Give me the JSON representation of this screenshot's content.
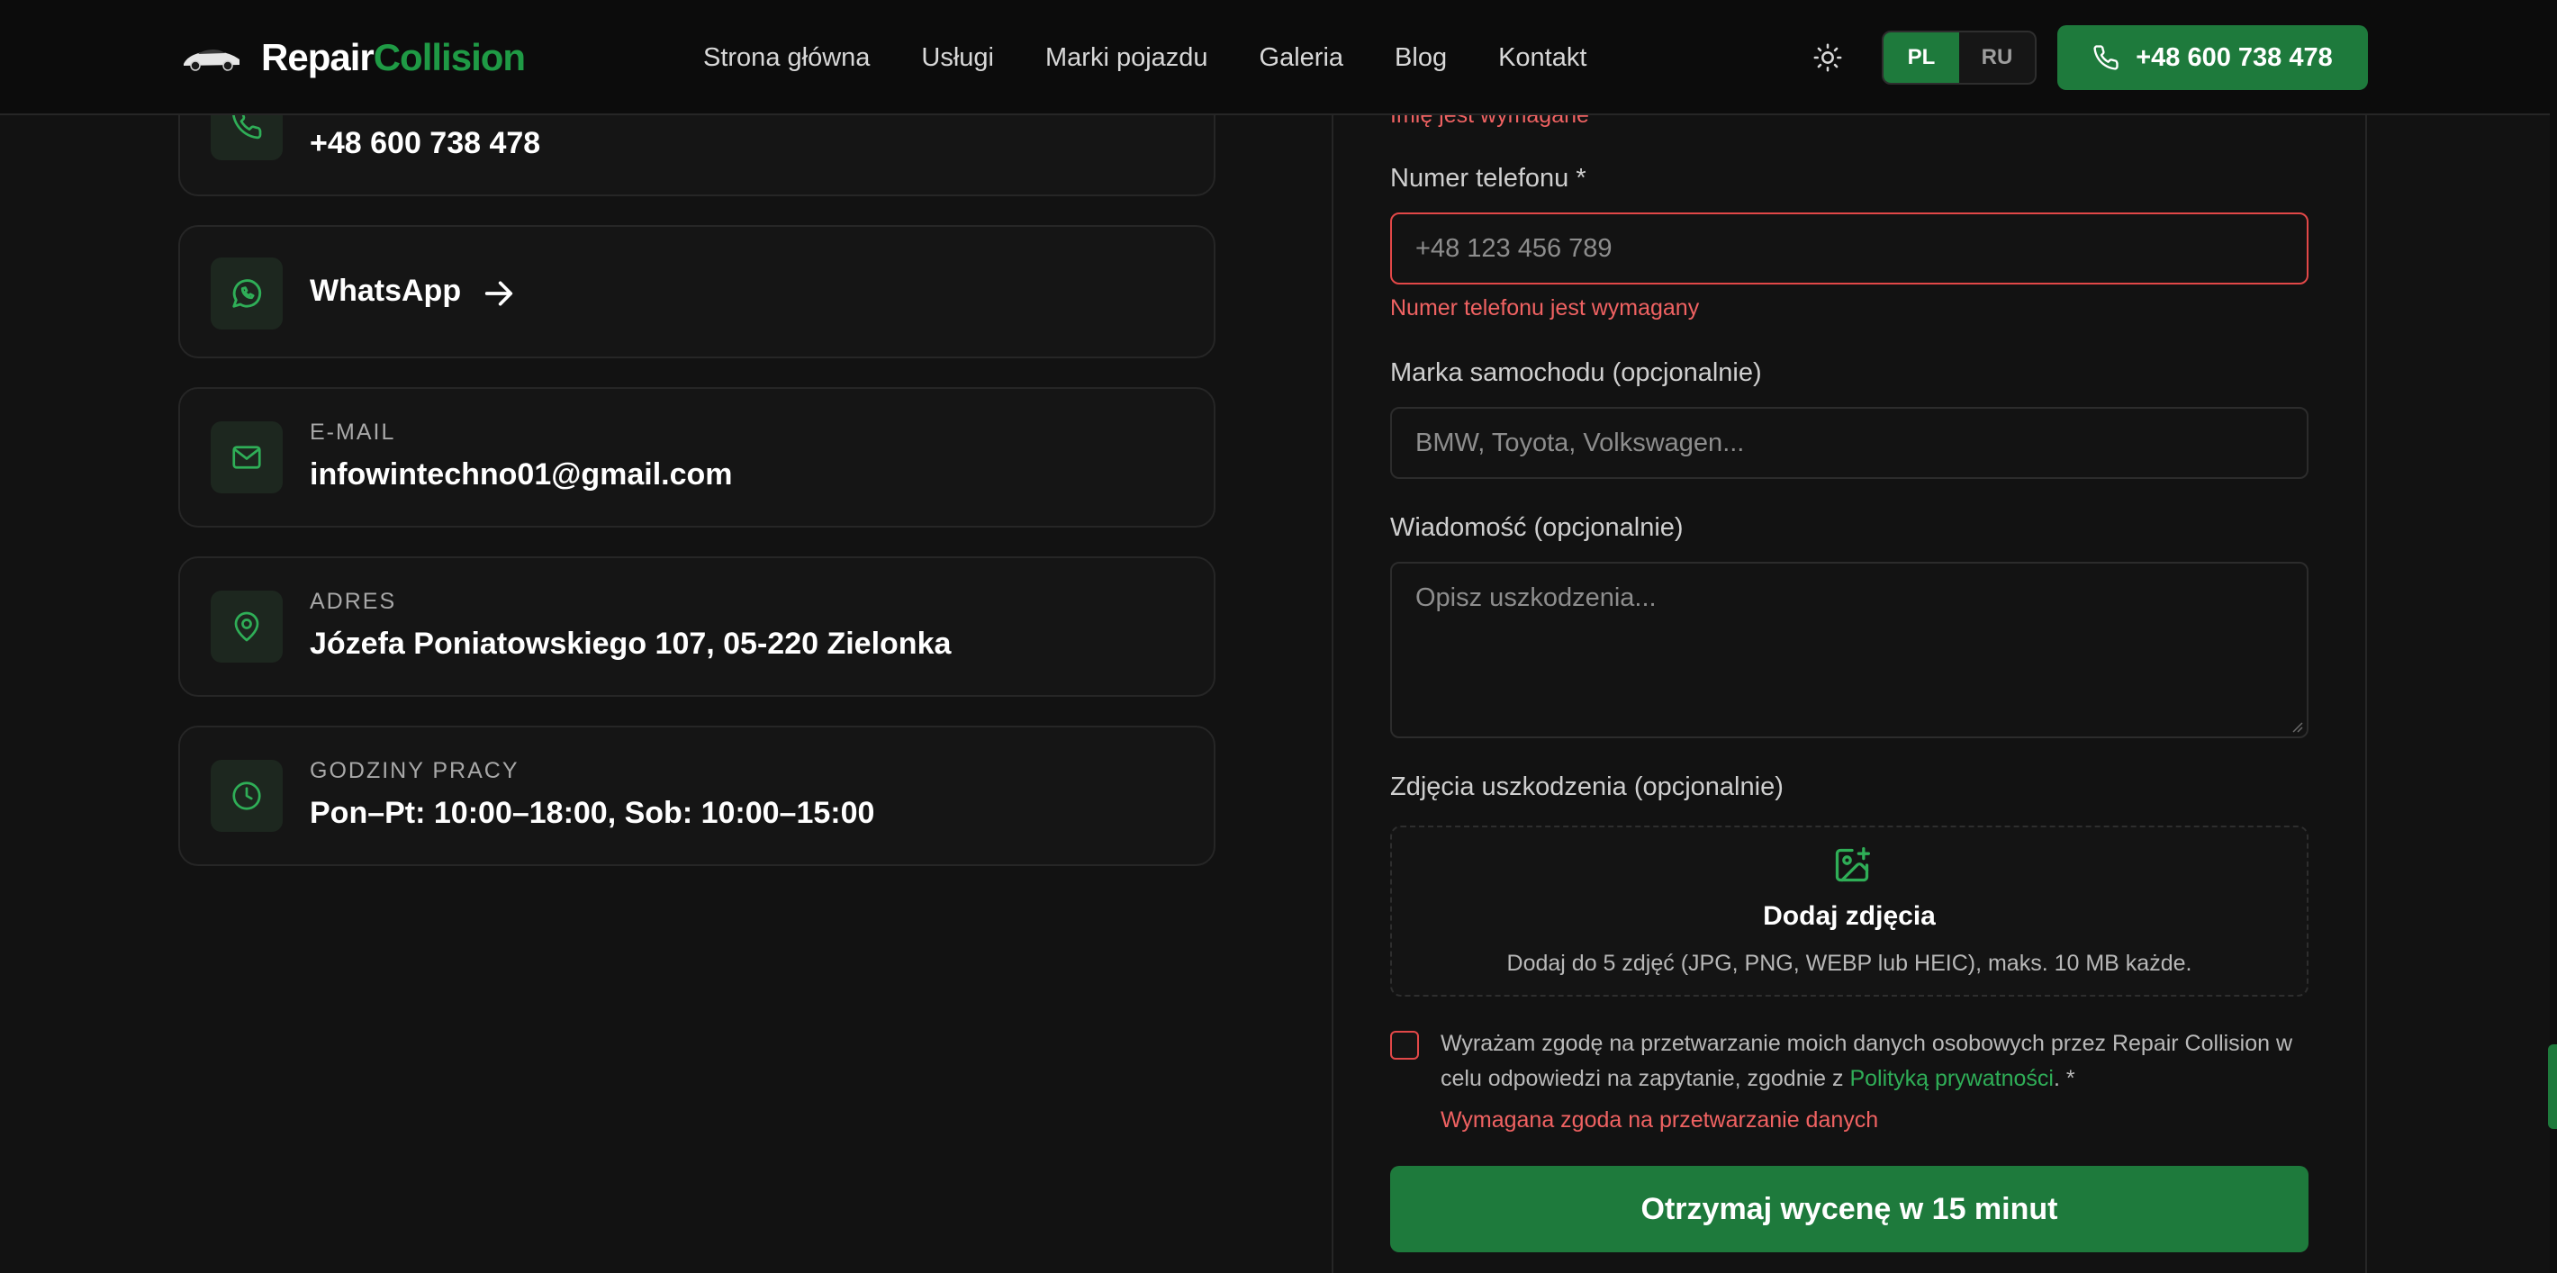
{
  "header": {
    "logo": {
      "part1": "Repair",
      "part2": "Collision"
    },
    "nav": [
      "Strona główna",
      "Usługi",
      "Marki pojazdu",
      "Galeria",
      "Blog",
      "Kontakt"
    ],
    "lang": {
      "pl": "PL",
      "ru": "RU",
      "selected": "PL"
    },
    "phone_button": "+48 600 738 478",
    "icons": {
      "theme": "sun-icon",
      "phone": "phone-icon"
    }
  },
  "contacts": {
    "phone_value": "+48 600 738 478",
    "whatsapp_value": "WhatsApp",
    "email": {
      "label": "E-MAIL",
      "value": "infowintechno01@gmail.com"
    },
    "address": {
      "label": "ADRES",
      "value": "Józefa Poniatowskiego 107, 05-220 Zielonka"
    },
    "hours": {
      "label": "GODZINY PRACY",
      "value": "Pon–Pt: 10:00–18:00, Sob: 10:00–15:00"
    }
  },
  "form": {
    "name_error": "Imię jest wymagane",
    "phone": {
      "label": "Numer telefonu *",
      "placeholder": "+48 123 456 789",
      "error": "Numer telefonu jest wymagany"
    },
    "brand": {
      "label": "Marka samochodu (opcjonalnie)",
      "placeholder": "BMW, Toyota, Volkswagen..."
    },
    "message": {
      "label": "Wiadomość (opcjonalnie)",
      "placeholder": "Opisz uszkodzenia..."
    },
    "photos": {
      "label": "Zdjęcia uszkodzenia (opcjonalnie)",
      "title": "Dodaj zdjęcia",
      "hint": "Dodaj do 5 zdjęć (JPG, PNG, WEBP lub HEIC), maks. 10 MB każde."
    },
    "consent": {
      "text_before": "Wyrażam zgodę na przetwarzanie moich danych osobowych przez Repair Collision w celu odpowiedzi na zapytanie, zgodnie z ",
      "link": "Polityką prywatności",
      "text_after": ". *",
      "error": "Wymagana zgoda na przetwarzanie danych"
    },
    "submit": "Otrzymaj wycenę w 15 minut"
  },
  "colors": {
    "accent": "#1e7a3c",
    "accent_light": "#2fae57",
    "error": "#f06262",
    "background": "#121212"
  }
}
